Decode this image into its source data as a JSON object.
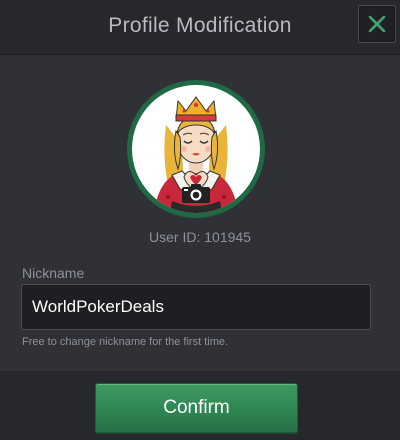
{
  "dialog": {
    "title": "Profile Modification",
    "close_icon": "close-x-icon"
  },
  "profile": {
    "avatar_icon": "queen-card-avatar",
    "camera_icon": "camera-icon",
    "user_id_label": "User ID:",
    "user_id_value": "101945"
  },
  "form": {
    "nickname_label": "Nickname",
    "nickname_value": "WorldPokerDeals",
    "hint": "Free to change nickname for the first time."
  },
  "footer": {
    "confirm_label": "Confirm"
  },
  "colors": {
    "accent_green": "#2f8653",
    "close_x": "#3ea66b",
    "avatar_ring": "#1f6a44"
  }
}
